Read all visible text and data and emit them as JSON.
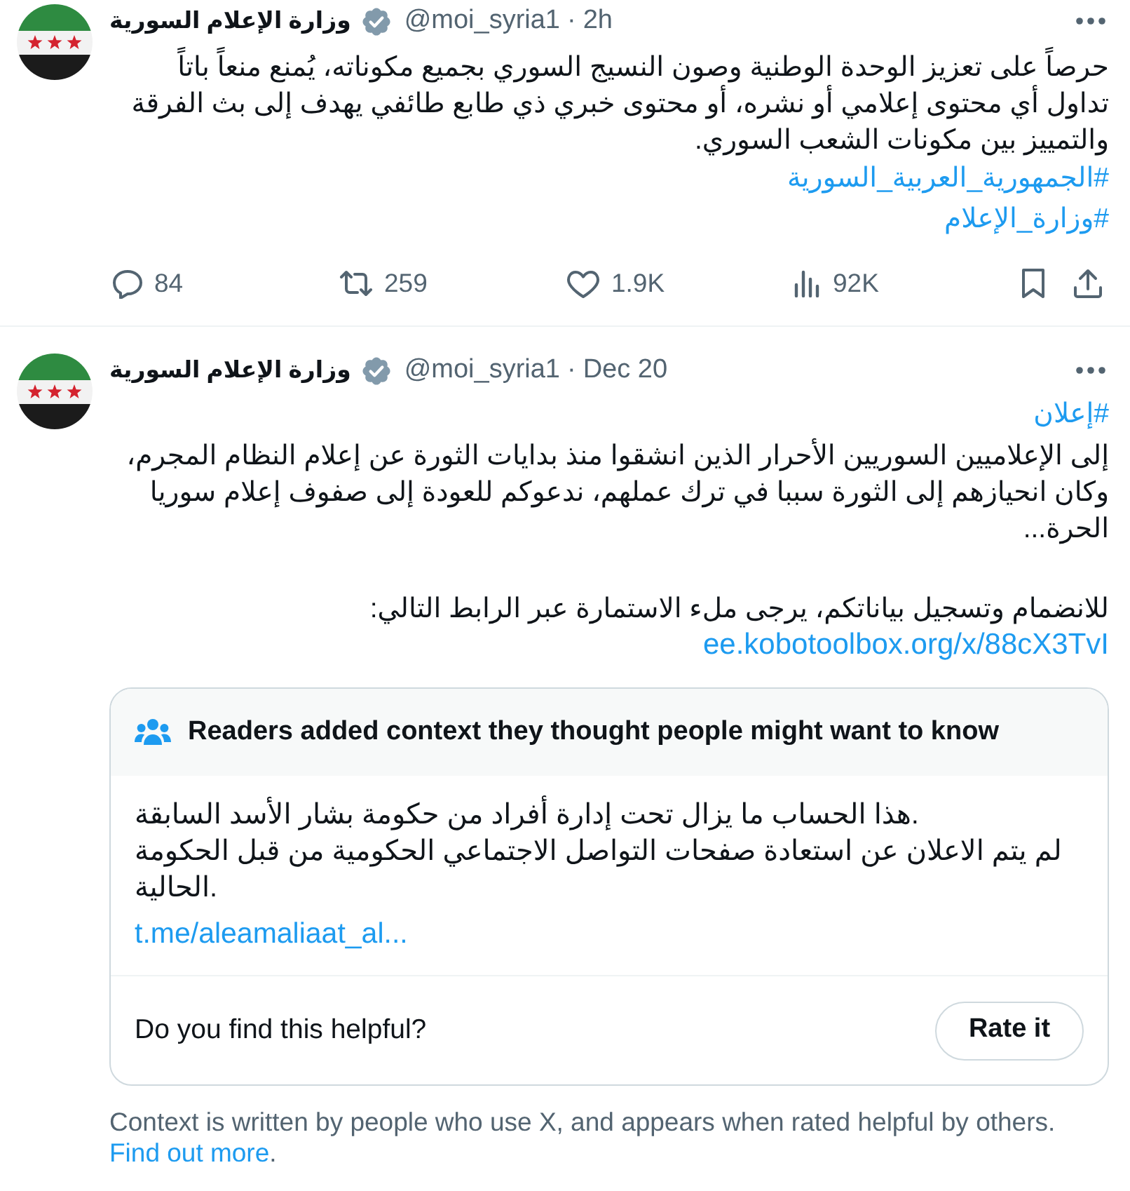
{
  "tweets": [
    {
      "author": {
        "name": "وزارة الإعلام السورية",
        "verified": true,
        "handle": "@moi_syria1"
      },
      "separator": "·",
      "time": "2h",
      "body": [
        {
          "kind": "text",
          "text": "حرصاً على تعزيز الوحدة الوطنية وصون النسيج السوري بجميع مكوناته، يُمنع منعاً باتاً تداول أي محتوى إعلامي أو نشره، أو محتوى خبري ذي طابع طائفي يهدف إلى بث الفرقة والتمييز بين مكونات الشعب السوري."
        },
        {
          "kind": "hashtag",
          "text": "#الجمهورية_العربية_السورية"
        },
        {
          "kind": "hashtag",
          "text": "#وزارة_الإعلام"
        }
      ],
      "counts": {
        "replies": "84",
        "reposts": "259",
        "likes": "1.9K",
        "views": "92K"
      }
    },
    {
      "author": {
        "name": "وزارة الإعلام السورية",
        "verified": true,
        "handle": "@moi_syria1"
      },
      "separator": "·",
      "time": "Dec 20",
      "body": [
        {
          "kind": "hashtag",
          "text": "#إعلان"
        },
        {
          "kind": "text",
          "text": "إلى الإعلاميين السوريين الأحرار الذين انشقوا منذ بدايات الثورة عن إعلام النظام المجرم، وكان انحيازهم إلى الثورة سببا في ترك عملهم، ندعوكم للعودة إلى صفوف إعلام سوريا الحرة..."
        },
        {
          "kind": "text",
          "text": "للانضمام وتسجيل بياناتكم، يرجى ملء الاستمارة عبر الرابط التالي:",
          "blank_line_before": true
        },
        {
          "kind": "link",
          "text": "ee.kobotoolbox.org/x/88cX3TvI"
        }
      ],
      "community_note": {
        "header": "Readers added context they thought people might want to know",
        "lines": [
          "هذا الحساب ما يزال تحت إدارة أفراد من حكومة بشار الأسد السابقة.",
          "لم يتم الاعلان عن استعادة صفحات التواصل الاجتماعي الحكومية من قبل الحكومة الحالية."
        ],
        "link": "t.me/aleamaliaat_al...",
        "prompt": "Do you find this helpful?",
        "button": "Rate it",
        "footer": {
          "text": "Context is written by people who use X, and appears when rated helpful by others.",
          "link": "Find out more",
          "trailing": "."
        }
      }
    }
  ]
}
